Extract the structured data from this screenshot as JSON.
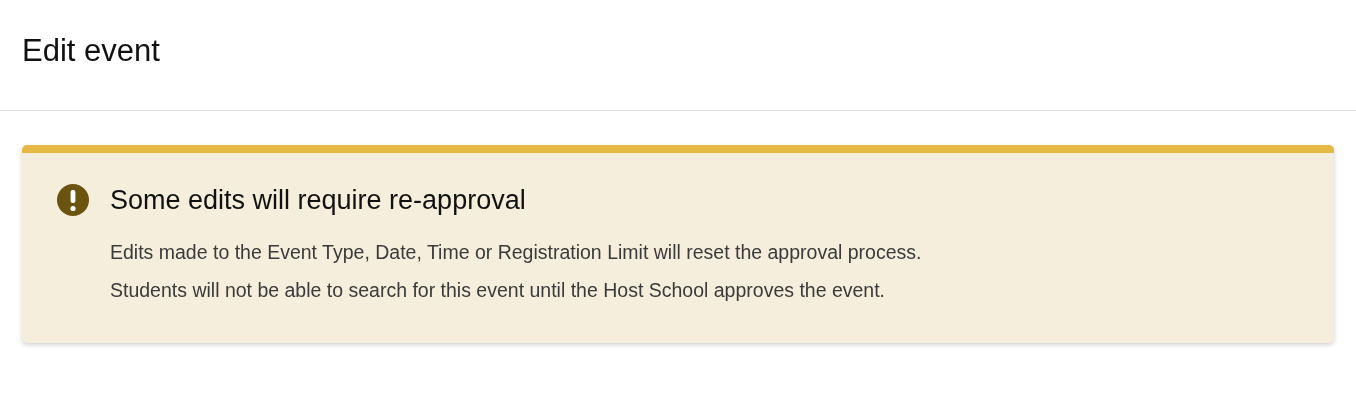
{
  "header": {
    "title": "Edit event"
  },
  "alert": {
    "kind": "warning",
    "title": "Some edits will require re-approval",
    "sentences": [
      "Edits made to the Event Type, Date, Time or Registration Limit will reset the approval process.",
      "Students will not be able to search for this event until the Host School approves the event."
    ]
  }
}
